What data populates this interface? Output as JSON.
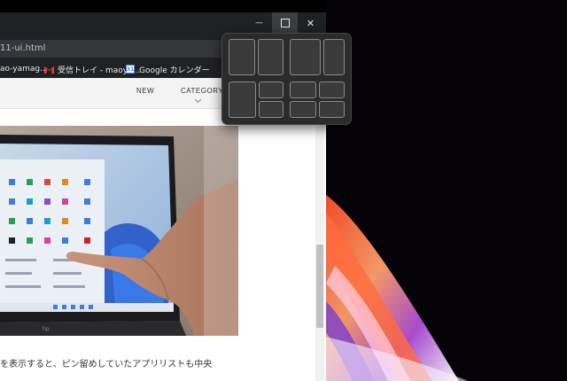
{
  "window": {
    "controls": {
      "minimize": "—",
      "close": "✕"
    }
  },
  "addressbar": {
    "url": "11-ui.html"
  },
  "bookmarks": [
    {
      "label": "ao-yamag..."
    },
    {
      "label": "受信トレイ - maoya..."
    },
    {
      "label": "Google カレンダー",
      "icon_text": "31"
    }
  ],
  "navbar": {
    "new_label": "NEW",
    "category_label": "CATEGORY"
  },
  "article": {
    "text": "を表示すると、ピン留めしていたアプリリストも中央"
  },
  "snap_layouts": {
    "layouts": [
      {
        "name": "two-column-even"
      },
      {
        "name": "two-column-wide-left"
      },
      {
        "name": "main-left-two-right"
      },
      {
        "name": "four-quadrants"
      }
    ]
  },
  "colors": {
    "titlebar": "#202124",
    "flyout": "#2b2b2b",
    "zone": "#3a3a3a"
  }
}
